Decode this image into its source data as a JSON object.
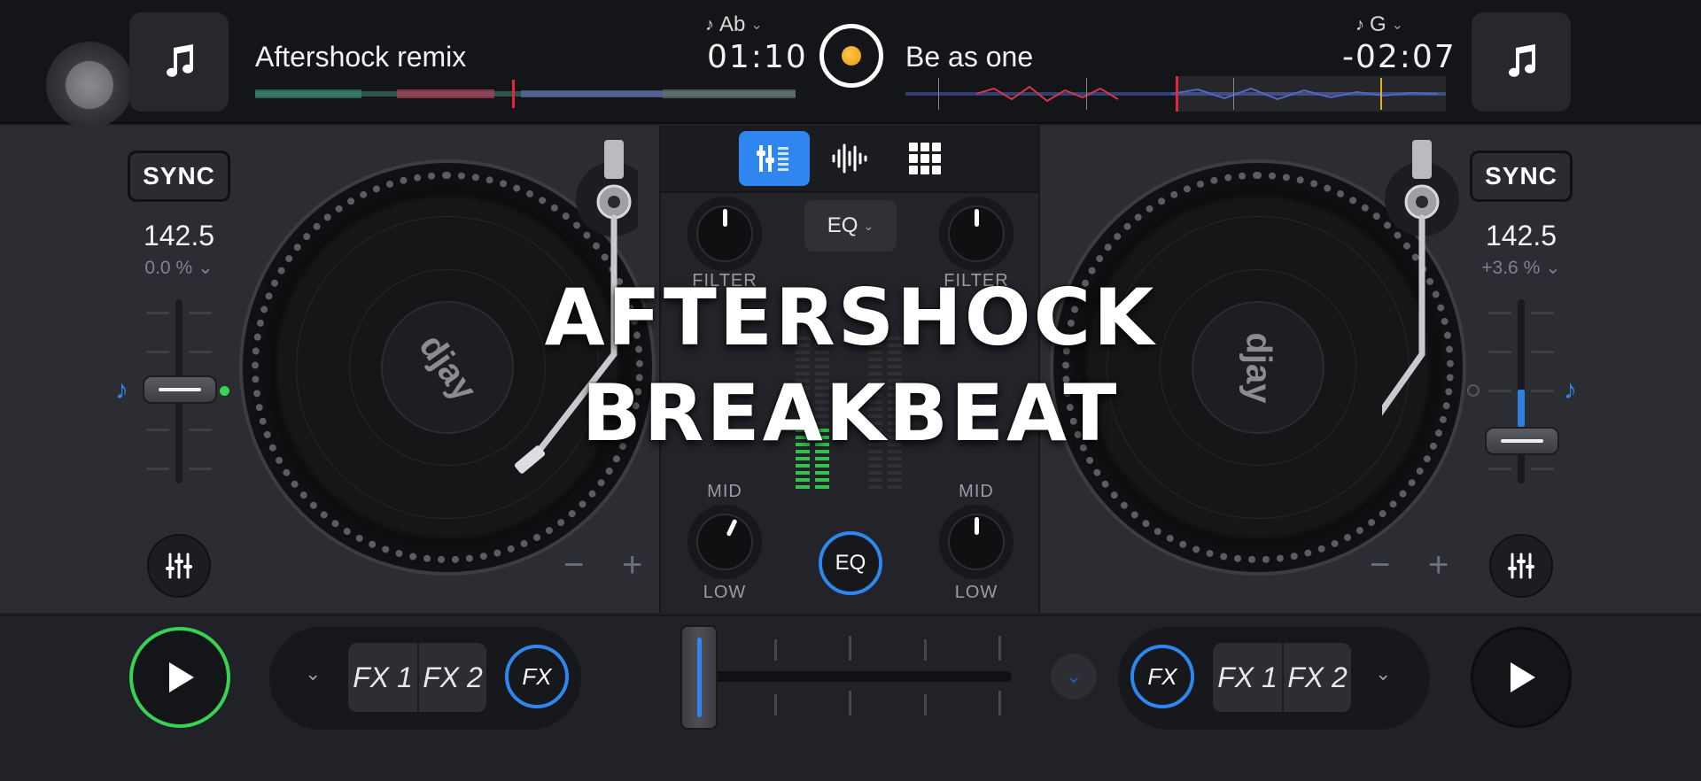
{
  "top": {
    "left_deck": {
      "title": "Aftershock remix",
      "key": "Ab",
      "time": "01:10"
    },
    "right_deck": {
      "title": "Be as one",
      "key": "G",
      "time": "-02:07"
    }
  },
  "decks": {
    "left": {
      "sync_label": "SYNC",
      "bpm": "142.5",
      "pitch": "0.0 %",
      "pitch_chevron": "⌄",
      "minus": "−",
      "plus": "+",
      "label_text": "djay"
    },
    "right": {
      "sync_label": "SYNC",
      "bpm": "142.5",
      "pitch": "+3.6 %",
      "pitch_chevron": "⌄",
      "minus": "−",
      "plus": "+",
      "label_text": "djay"
    }
  },
  "mixer": {
    "tabs": [
      "mixer-tab-icon",
      "waveform-tab-icon",
      "grid-tab-icon"
    ],
    "eq_dropdown": "EQ",
    "eq_button": "EQ",
    "labels": {
      "filter_left": "FILTER",
      "filter_right": "FILTER",
      "mid_left": "MID",
      "mid_right": "MID",
      "low_left": "LOW",
      "low_right": "LOW"
    }
  },
  "bottom": {
    "left_fx": {
      "fx1": "FX 1",
      "fx2": "FX 2",
      "fx_round": "FX"
    },
    "right_fx": {
      "fx1": "FX 1",
      "fx2": "FX 2",
      "fx_round": "FX"
    },
    "crossfader_value": 0.0
  },
  "overlay": {
    "line1": "AFTERSHOCK",
    "line2": "BREAKBEAT"
  },
  "colors": {
    "accent_blue": "#2f86f0",
    "play_green": "#39d353",
    "vinyl_black": "#151618"
  }
}
